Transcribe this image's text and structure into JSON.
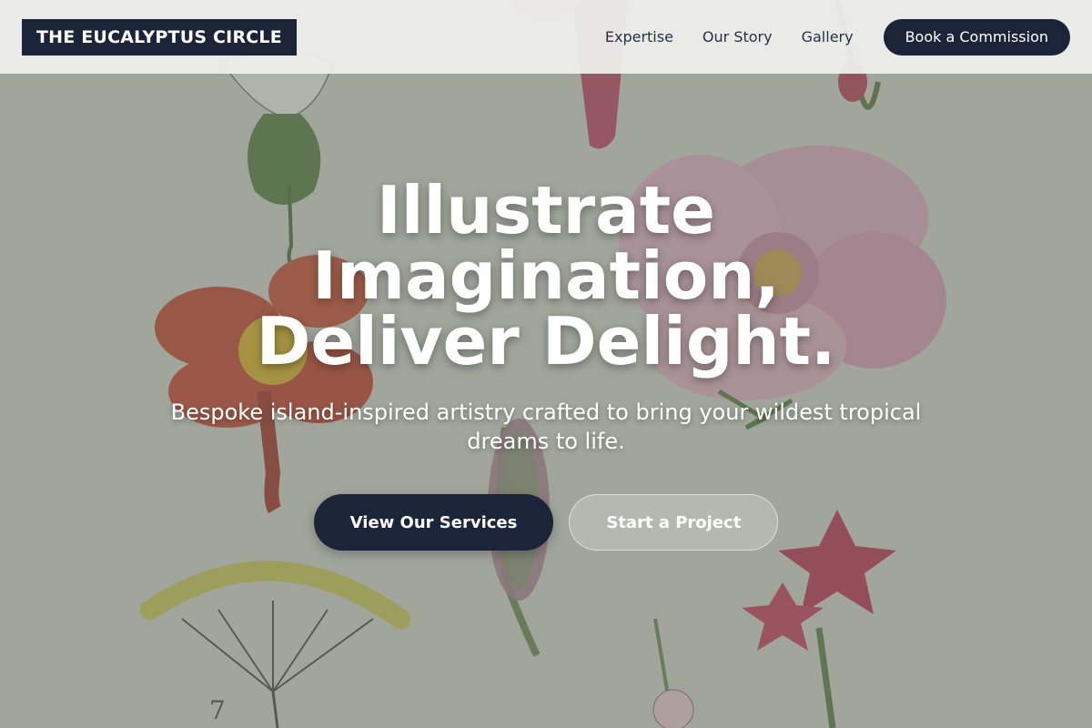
{
  "header": {
    "logo": "THE EUCALYPTUS CIRCLE",
    "nav": [
      {
        "label": "Expertise"
      },
      {
        "label": "Our Story"
      },
      {
        "label": "Gallery"
      }
    ],
    "cta_label": "Book a Commission"
  },
  "hero": {
    "title_lines": [
      "Illustrate",
      "Imagination,",
      "Deliver Delight."
    ],
    "subtitle": "Bespoke island-inspired artistry crafted to bring your wildest tropical dreams to life.",
    "primary_button": "View Our Services",
    "secondary_button": "Start a Project",
    "background": "botanical-flowers-illustration"
  },
  "colors": {
    "navy": "#1b2438",
    "header_bg": "#f0f0ee",
    "nav_text": "#283045",
    "white": "#ffffff"
  }
}
